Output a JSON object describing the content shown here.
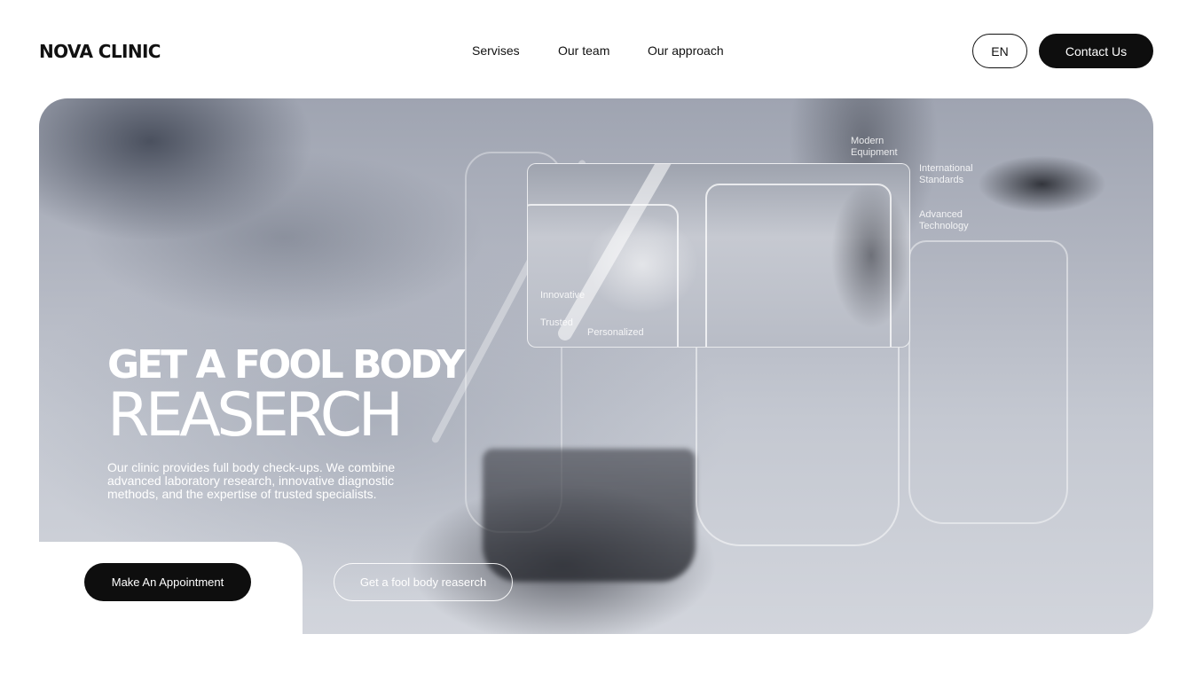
{
  "header": {
    "logo": "NOVA CLINIC",
    "nav": [
      "Servises",
      "Our team",
      "Our approach"
    ],
    "lang": "EN",
    "contact": "Contact Us"
  },
  "hero": {
    "title_line1": "GET A FOOL BODY",
    "title_line2": "REASERCH",
    "description": "Our clinic provides full body check-ups. We combine advanced laboratory research, innovative diagnostic methods, and the expertise of trusted specialists.",
    "tags": {
      "modern_equipment": "Modern Equipment",
      "international_standards": "International Standards",
      "advanced_technology": "Advanced Technology",
      "innovative": "Innovative",
      "trusted": "Trusted",
      "personalized": "Personalized"
    },
    "primary_button": "Make An Appointment",
    "secondary_button": "Get a fool body reaserch"
  }
}
